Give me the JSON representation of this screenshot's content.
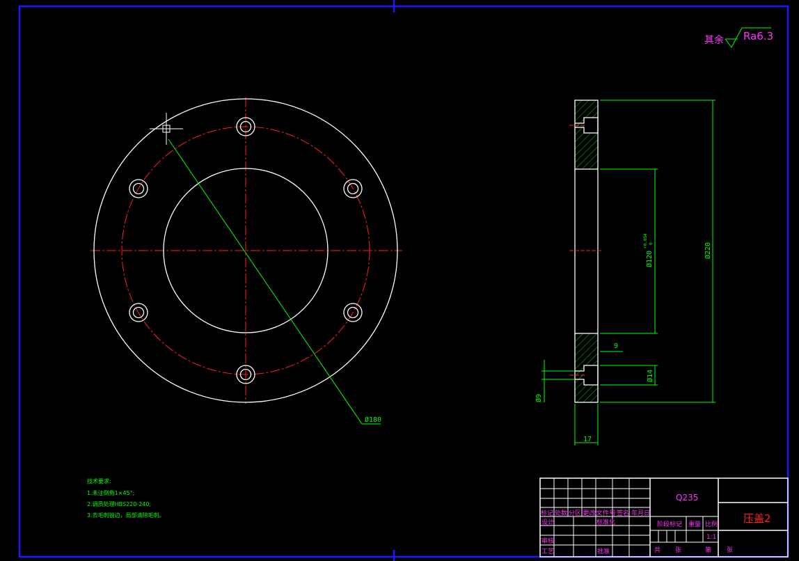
{
  "surface": {
    "label": "其余",
    "value": "Ra6.3"
  },
  "dimensions": {
    "pcd": "Ø180",
    "outer": "Ø220",
    "bore": "Ø120",
    "bore_tol_upper": "+0.054",
    "bore_tol_lower": "0",
    "counterbore_depth": "9",
    "counterbore_dia": "Ø14",
    "hole_dia": "Ø9",
    "thickness": "17"
  },
  "tech_req": {
    "title": "技术要求:",
    "items": [
      "1.未注倒角1×45°;",
      "2.调质处理HBS220-240;",
      "3.去毛刺锐边，局部清除毛刺。"
    ]
  },
  "title_block": {
    "material": "Q235",
    "part_name": "压盖2",
    "scale": "1:1",
    "header_cells": [
      "标记",
      "处数",
      "分区",
      "更改文件号",
      "签名",
      "年月日"
    ],
    "design": "设计",
    "standard": "标准化",
    "stage_mark": "阶段标记",
    "weight": "重量",
    "ratio": "比例",
    "review": "审核",
    "process": "工艺",
    "approve": "批准",
    "total": "共",
    "sheets": "张",
    "sheet_no": "第",
    "sheets2": "张"
  },
  "colors": {
    "background": "#000000",
    "border": "#1a1aff",
    "outline": "#ffffff",
    "centerline": "#ff2020",
    "dimension": "#00ff00",
    "text_magenta": "#ff33ff",
    "hatch": "#00cc00"
  }
}
